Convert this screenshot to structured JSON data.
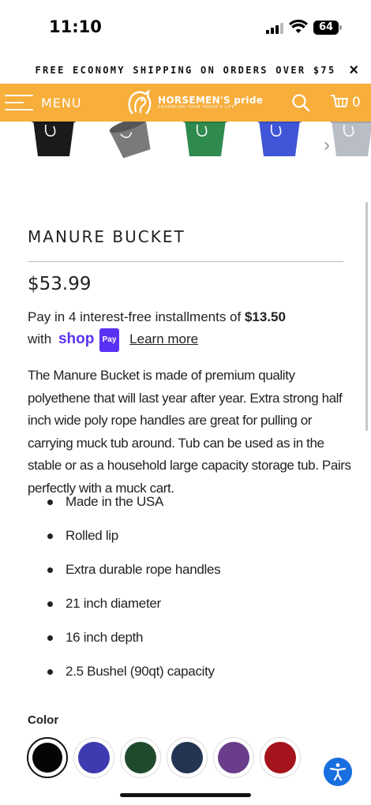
{
  "status_bar": {
    "time": "11:10",
    "battery": "64"
  },
  "promo": {
    "text": "FREE ECONOMY SHIPPING ON ORDERS OVER $75",
    "close": "×"
  },
  "nav": {
    "menu_label": "MENU",
    "logo_text": "HORSEMEN'S pride",
    "logo_tagline": "ENHANCING YOUR HORSE'S LIFE",
    "cart_count": "0"
  },
  "gallery": {
    "thumbnails": [
      {
        "color_name": "black",
        "color": "#1a1a1a"
      },
      {
        "color_name": "gray",
        "color": "#7a7a7a"
      },
      {
        "color_name": "green",
        "color": "#2f8a4e"
      },
      {
        "color_name": "blue",
        "color": "#3f56d8"
      },
      {
        "color_name": "silver",
        "color": "#b9bec6"
      }
    ],
    "next_arrow": "›"
  },
  "product": {
    "title": "MANURE BUCKET",
    "price": "$53.99",
    "installments_prefix": "Pay in 4 interest-free installments of ",
    "installments_amount": "$13.50",
    "installments_with": "with",
    "shop_label": "shop",
    "pay_label": "Pay",
    "learn_more": "Learn more",
    "description": "The Manure Bucket is made of premium quality polyethene that will last year after year. Extra strong half inch wide poly rope handles are great for pulling or carrying muck tub around. Tub can be used as in the stable or as a household large capacity storage tub. Pairs perfectly with a muck cart.",
    "features": [
      "Made in the USA",
      "Rolled lip",
      "Extra durable rope handles",
      "21 inch diameter",
      "16 inch depth",
      "2.5 Bushel (90qt) capacity"
    ]
  },
  "color_picker": {
    "label": "Color",
    "selected": "black",
    "swatches": [
      {
        "name": "black",
        "color": "#050505"
      },
      {
        "name": "blue",
        "color": "#3e3ab0"
      },
      {
        "name": "green",
        "color": "#204a2c"
      },
      {
        "name": "navy",
        "color": "#233552"
      },
      {
        "name": "purple",
        "color": "#6a3d8a"
      },
      {
        "name": "red",
        "color": "#a5131c"
      }
    ]
  },
  "accessibility_icon": "accessibility-icon"
}
